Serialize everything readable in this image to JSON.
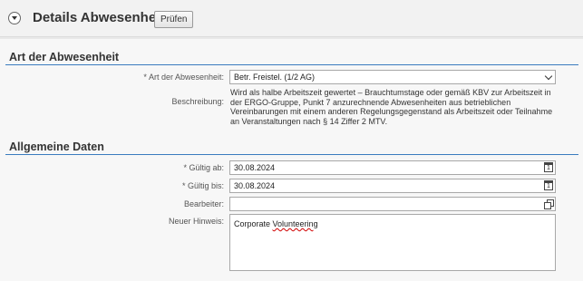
{
  "header": {
    "title": "Details Abwesenheit",
    "check_button": "Prüfen"
  },
  "section_absence": {
    "title": "Art der Abwesenheit",
    "type_label": "Art der Abwesenheit:",
    "type_value": "Betr. Freistel.  (1/2 AG)",
    "description_label": "Beschreibung:",
    "description_text": "Wird als halbe Arbeitszeit gewertet – Brauchtumstage oder gemäß KBV zur Arbeitszeit in der ERGO-Gruppe, Punkt 7 anzurechnende Abwesenheiten aus betrieblichen Vereinbarungen mit einem anderen Regelungsgegenstand als Arbeitszeit oder Teilnahme an Veranstaltungen nach § 14 Ziffer 2 MTV."
  },
  "section_general": {
    "title": "Allgemeine Daten",
    "valid_from_label": "Gültig ab:",
    "valid_from_value": "30.08.2024",
    "valid_to_label": "Gültig bis:",
    "valid_to_value": "30.08.2024",
    "processor_label": "Bearbeiter:",
    "processor_value": "",
    "note_label": "Neuer Hinweis:",
    "note_text_prefix": "Corporate ",
    "note_text_misspelled": "Volunteering"
  },
  "required_marker": "*",
  "calendar_icon_day": "1"
}
